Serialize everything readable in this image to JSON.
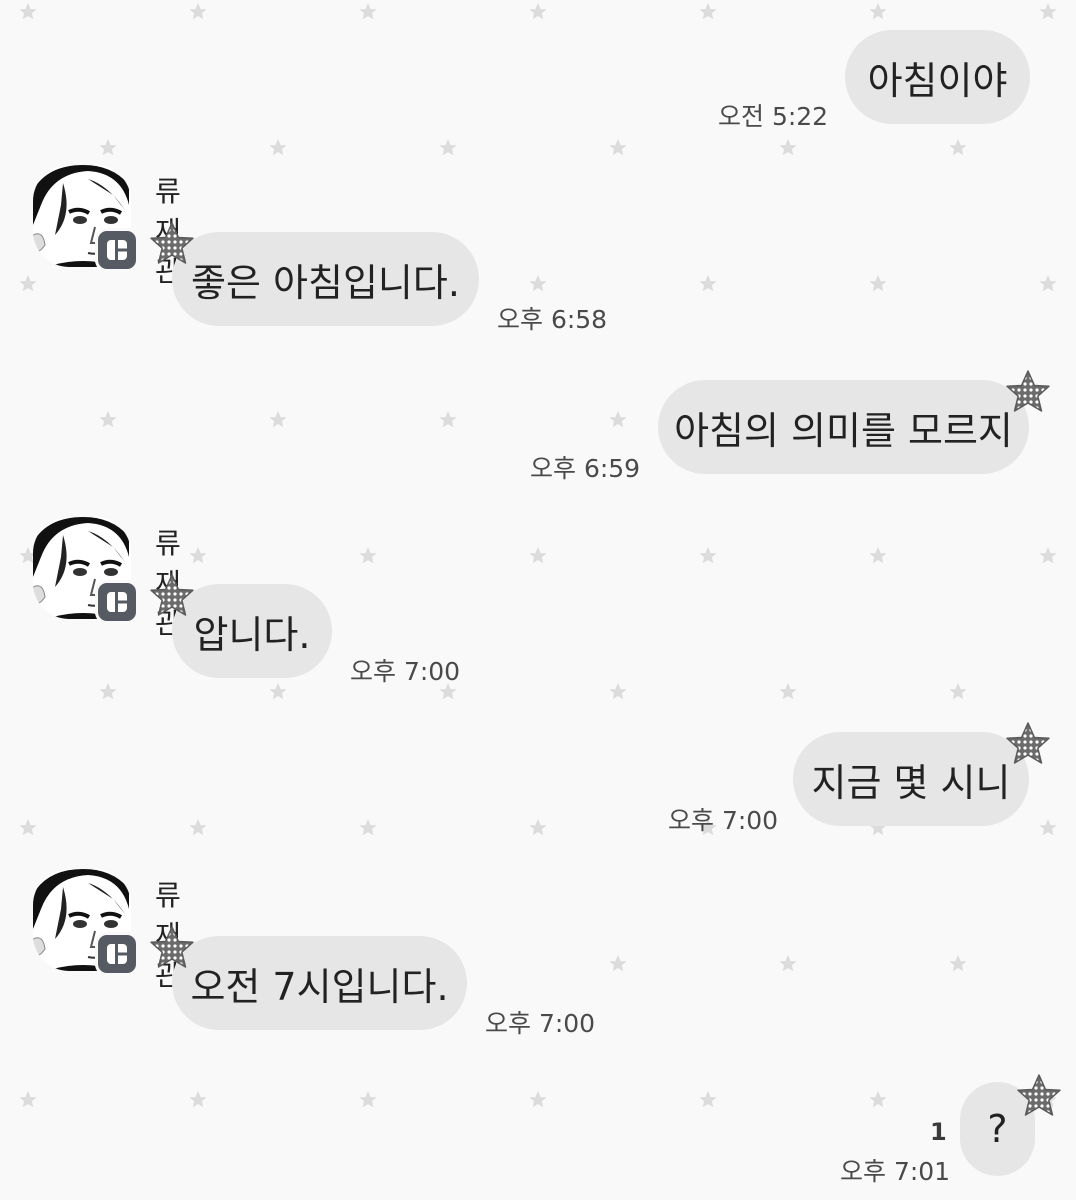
{
  "messages": [
    {
      "side": "right",
      "text": "아침이야",
      "time": "오전 5:22"
    },
    {
      "side": "left",
      "sender": "류재관",
      "text": "좋은 아침입니다.",
      "time": "오후 6:58"
    },
    {
      "side": "right",
      "text": "아침의 의미를 모르지",
      "time": "오후 6:59"
    },
    {
      "side": "left",
      "sender": "류재관",
      "text": "압니다.",
      "time": "오후 7:00"
    },
    {
      "side": "right",
      "text": "지금 몇 시니",
      "time": "오후 7:00"
    },
    {
      "side": "left",
      "sender": "류재관",
      "text": "오전 7시입니다.",
      "time": "오후 7:00"
    },
    {
      "side": "right",
      "text": "?",
      "time": "오후 7:01",
      "unread_count": "1"
    }
  ],
  "colors": {
    "background": "#f9f9f9",
    "bubble": "#e6e6e6",
    "background_star": "#dcdcdc",
    "badge": "#565a62"
  },
  "icons": {
    "avatar": "profile-photo-icon",
    "badge": "app-badge-icon",
    "sticker": "polka-dot-star-icon",
    "background": "star-pattern-icon"
  }
}
